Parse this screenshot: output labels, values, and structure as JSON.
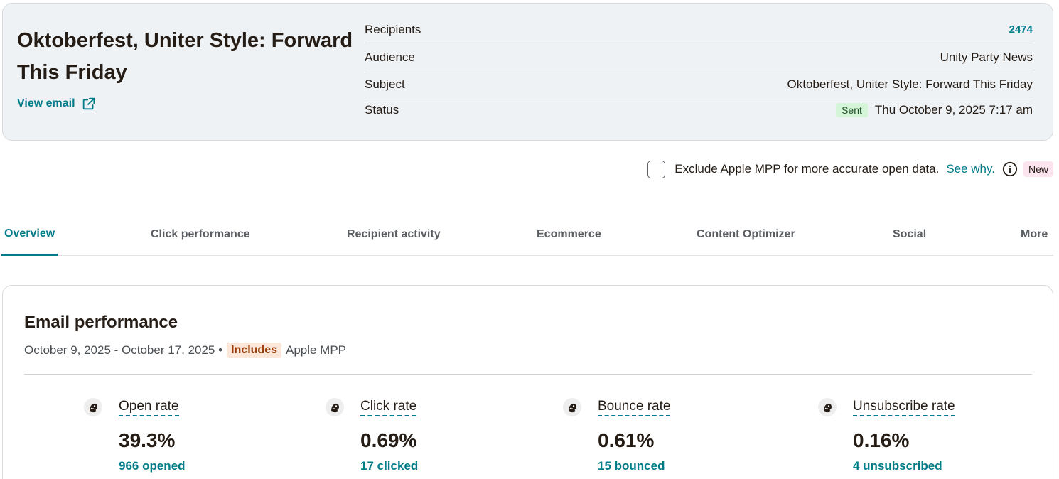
{
  "campaign": {
    "title": "Oktoberfest, Uniter Style: Forward This Friday",
    "view_email_label": "View email",
    "details": {
      "recipients_label": "Recipients",
      "recipients_value": "2474",
      "audience_label": "Audience",
      "audience_value": "Unity Party News",
      "subject_label": "Subject",
      "subject_value": "Oktoberfest, Uniter Style: Forward This Friday",
      "status_label": "Status",
      "status_badge": "Sent",
      "status_date": "Thu October 9, 2025 7:17 am"
    }
  },
  "mpp": {
    "checkbox_checked": false,
    "text": "Exclude Apple MPP for more accurate open data.",
    "link": "See why.",
    "new_badge": "New"
  },
  "tabs": [
    {
      "label": "Overview",
      "active": true
    },
    {
      "label": "Click performance",
      "active": false
    },
    {
      "label": "Recipient activity",
      "active": false
    },
    {
      "label": "Ecommerce",
      "active": false
    },
    {
      "label": "Content Optimizer",
      "active": false
    },
    {
      "label": "Social",
      "active": false
    },
    {
      "label": "More",
      "active": false
    }
  ],
  "performance": {
    "title": "Email performance",
    "date_range": "October 9, 2025 - October 17, 2025 •",
    "includes_badge": "Includes",
    "mpp_label": "Apple MPP",
    "metrics": [
      {
        "label": "Open rate",
        "value": "39.3%",
        "sub": "966 opened",
        "icon": "mailchimp-freddie-icon"
      },
      {
        "label": "Click rate",
        "value": "0.69%",
        "sub": "17 clicked",
        "icon": "mailchimp-freddie-icon"
      },
      {
        "label": "Bounce rate",
        "value": "0.61%",
        "sub": "15 bounced",
        "icon": "mailchimp-freddie-icon"
      },
      {
        "label": "Unsubscribe rate",
        "value": "0.16%",
        "sub": "4 unsubscribed",
        "icon": "mailchimp-freddie-icon"
      }
    ]
  },
  "colors": {
    "accent": "#007c89",
    "text": "#241c15",
    "card_bg": "#eff2f5",
    "sent_badge_bg": "#d4f5d7",
    "new_badge_bg": "#fce4ee",
    "includes_badge_bg": "#fbe6da",
    "includes_badge_text": "#9c3e0a"
  }
}
